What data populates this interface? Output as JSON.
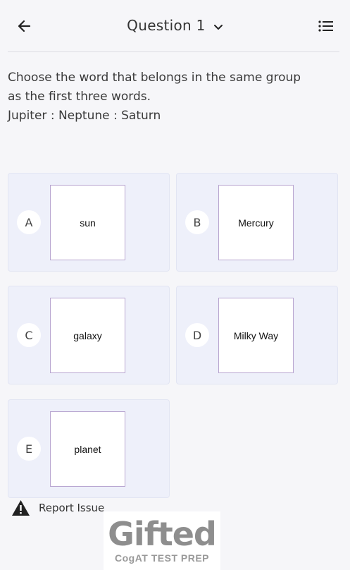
{
  "header": {
    "title": "Question 1",
    "back_icon": "arrow-left-icon",
    "dropdown_icon": "chevron-down-icon",
    "list_icon": "question-list-icon"
  },
  "question": {
    "line1": "Choose the word that belongs in the same group",
    "line2": "as the first three words.",
    "line3": "Jupiter : Neptune : Saturn"
  },
  "options": [
    {
      "letter": "A",
      "text": "sun"
    },
    {
      "letter": "B",
      "text": "Mercury"
    },
    {
      "letter": "C",
      "text": "galaxy"
    },
    {
      "letter": "D",
      "text": "Milky Way"
    },
    {
      "letter": "E",
      "text": "planet"
    }
  ],
  "report": {
    "label": "Report Issue",
    "icon": "warning-icon"
  },
  "logo": {
    "word": "Gifted",
    "tagline": "CogAT TEST PREP"
  },
  "colors": {
    "background": "#f6f6f9",
    "card": "#eef0fa",
    "option_border": "#b8a5d0"
  }
}
